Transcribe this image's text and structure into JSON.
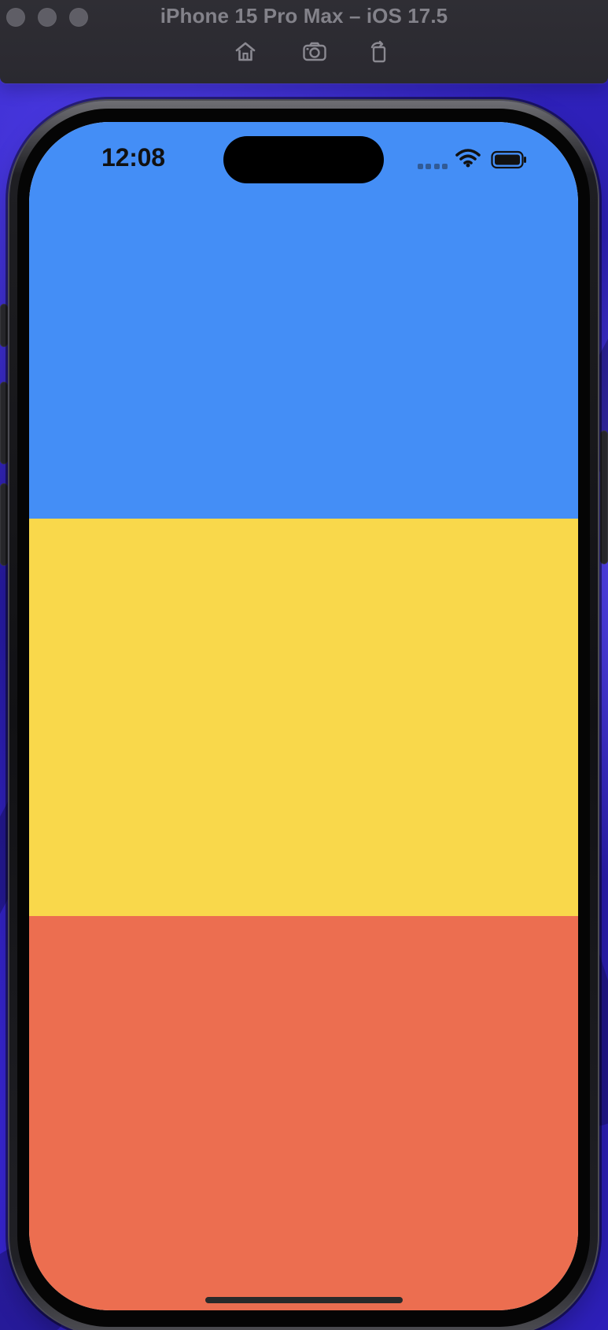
{
  "window": {
    "title": "iPhone 15 Pro Max – iOS 17.5",
    "toolbar": {
      "home_icon": "home-icon",
      "screenshot_icon": "camera-icon",
      "rotate_icon": "rotate-icon"
    }
  },
  "status_bar": {
    "time": "12:08",
    "signal_icon": "signal-dots-icon",
    "wifi_icon": "wifi-icon",
    "battery_icon": "battery-icon"
  },
  "screen": {
    "bands": [
      {
        "name": "blue-band",
        "color": "#448EF6"
      },
      {
        "name": "yellow-band",
        "color": "#F9D84B"
      },
      {
        "name": "red-band",
        "color": "#EC6E50"
      }
    ]
  },
  "colors": {
    "titlebar": "#2F2E34",
    "title_text": "#83828A",
    "wallpaper": "#2D1FB8",
    "device_frame": "#111114",
    "home_indicator": "#2A2A2A"
  }
}
